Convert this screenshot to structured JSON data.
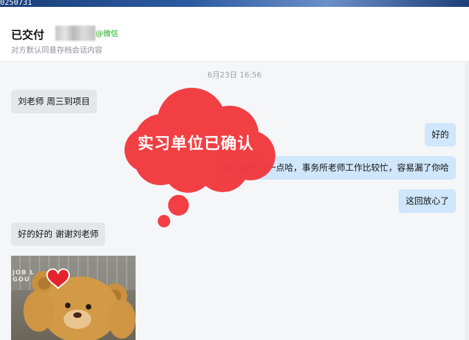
{
  "window": {
    "top_strip_text": "0250731"
  },
  "header": {
    "title": "已交付",
    "wechat_tag": "@微信",
    "subtitle": "对方默认同意存档会话内容"
  },
  "chat": {
    "timestamp": "6月23日 16:56",
    "messages": [
      {
        "side": "left",
        "text": "刘老师 周三到项目"
      },
      {
        "side": "right",
        "text": "好的"
      },
      {
        "side": "right",
        "text": "自己要主动一点哈，事务所老师工作比较忙，容易漏了你哈"
      },
      {
        "side": "right",
        "text": "这回放心了"
      },
      {
        "side": "left",
        "text": "好的好的 谢谢刘老师"
      }
    ],
    "photo_sign_text": "JOB L\nGOU"
  },
  "sticker": {
    "text": "实习单位已确认",
    "color": "#f23a3f",
    "icon": "thought-bubble-icon"
  },
  "photo": {
    "icon": "teddy-bear-heart-icon"
  },
  "colors": {
    "left_bubble": "#e4e6ea",
    "right_bubble": "#cfe6fb",
    "wechat_green": "#1aad19",
    "sticker_red": "#f23a3f"
  }
}
